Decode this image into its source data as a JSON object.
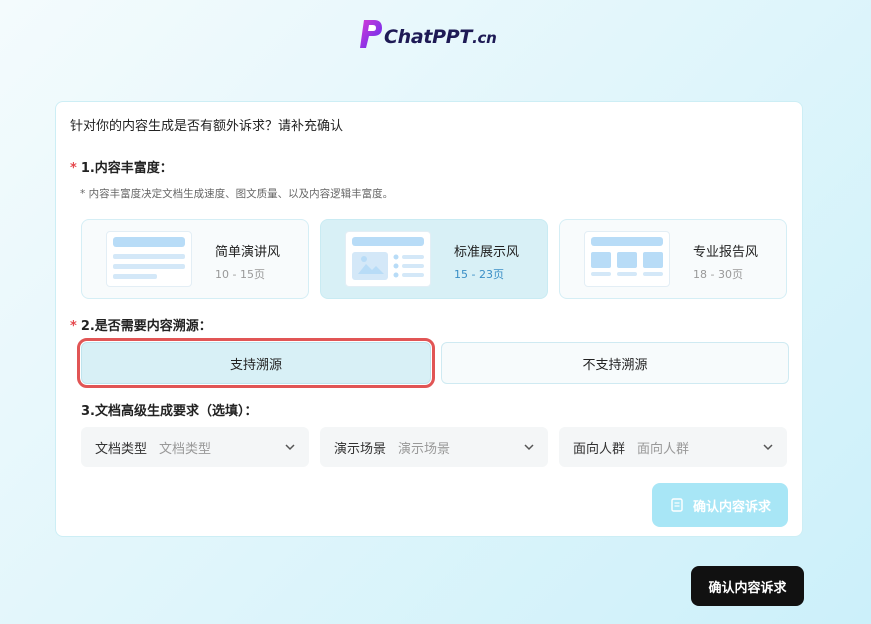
{
  "logo": {
    "text_main": "ChatPPT",
    "text_suffix": ".cn"
  },
  "question": "针对你的内容生成是否有额外诉求？请补充确认",
  "sections": {
    "richness": {
      "required_mark": "*",
      "title": "1.内容丰富度：",
      "hint": "* 内容丰富度决定文档生成速度、图文质量、以及内容逻辑丰富度。",
      "options": [
        {
          "title": "简单演讲风",
          "pages": "10 - 15页",
          "selected": false
        },
        {
          "title": "标准展示风",
          "pages": "15 - 23页",
          "selected": true
        },
        {
          "title": "专业报告风",
          "pages": "18 - 30页",
          "selected": false
        }
      ]
    },
    "trace": {
      "required_mark": "*",
      "title": "2.是否需要内容溯源：",
      "options": [
        {
          "label": "支持溯源",
          "selected": true
        },
        {
          "label": "不支持溯源",
          "selected": false
        }
      ]
    },
    "advanced": {
      "title": "3.文档高级生成要求（选填）：",
      "selects": [
        {
          "label": "文档类型",
          "placeholder": "文档类型"
        },
        {
          "label": "演示场景",
          "placeholder": "演示场景"
        },
        {
          "label": "面向人群",
          "placeholder": "面向人群"
        }
      ]
    }
  },
  "buttons": {
    "confirm_inner": "确认内容诉求",
    "confirm_outer": "确认内容诉求"
  },
  "colors": {
    "accent": "#a8e6f6",
    "selected_bg": "#d8f0f6",
    "highlight_outline": "#e15555",
    "required": "#e5484d",
    "logo_purple": "#7b3cf0"
  }
}
